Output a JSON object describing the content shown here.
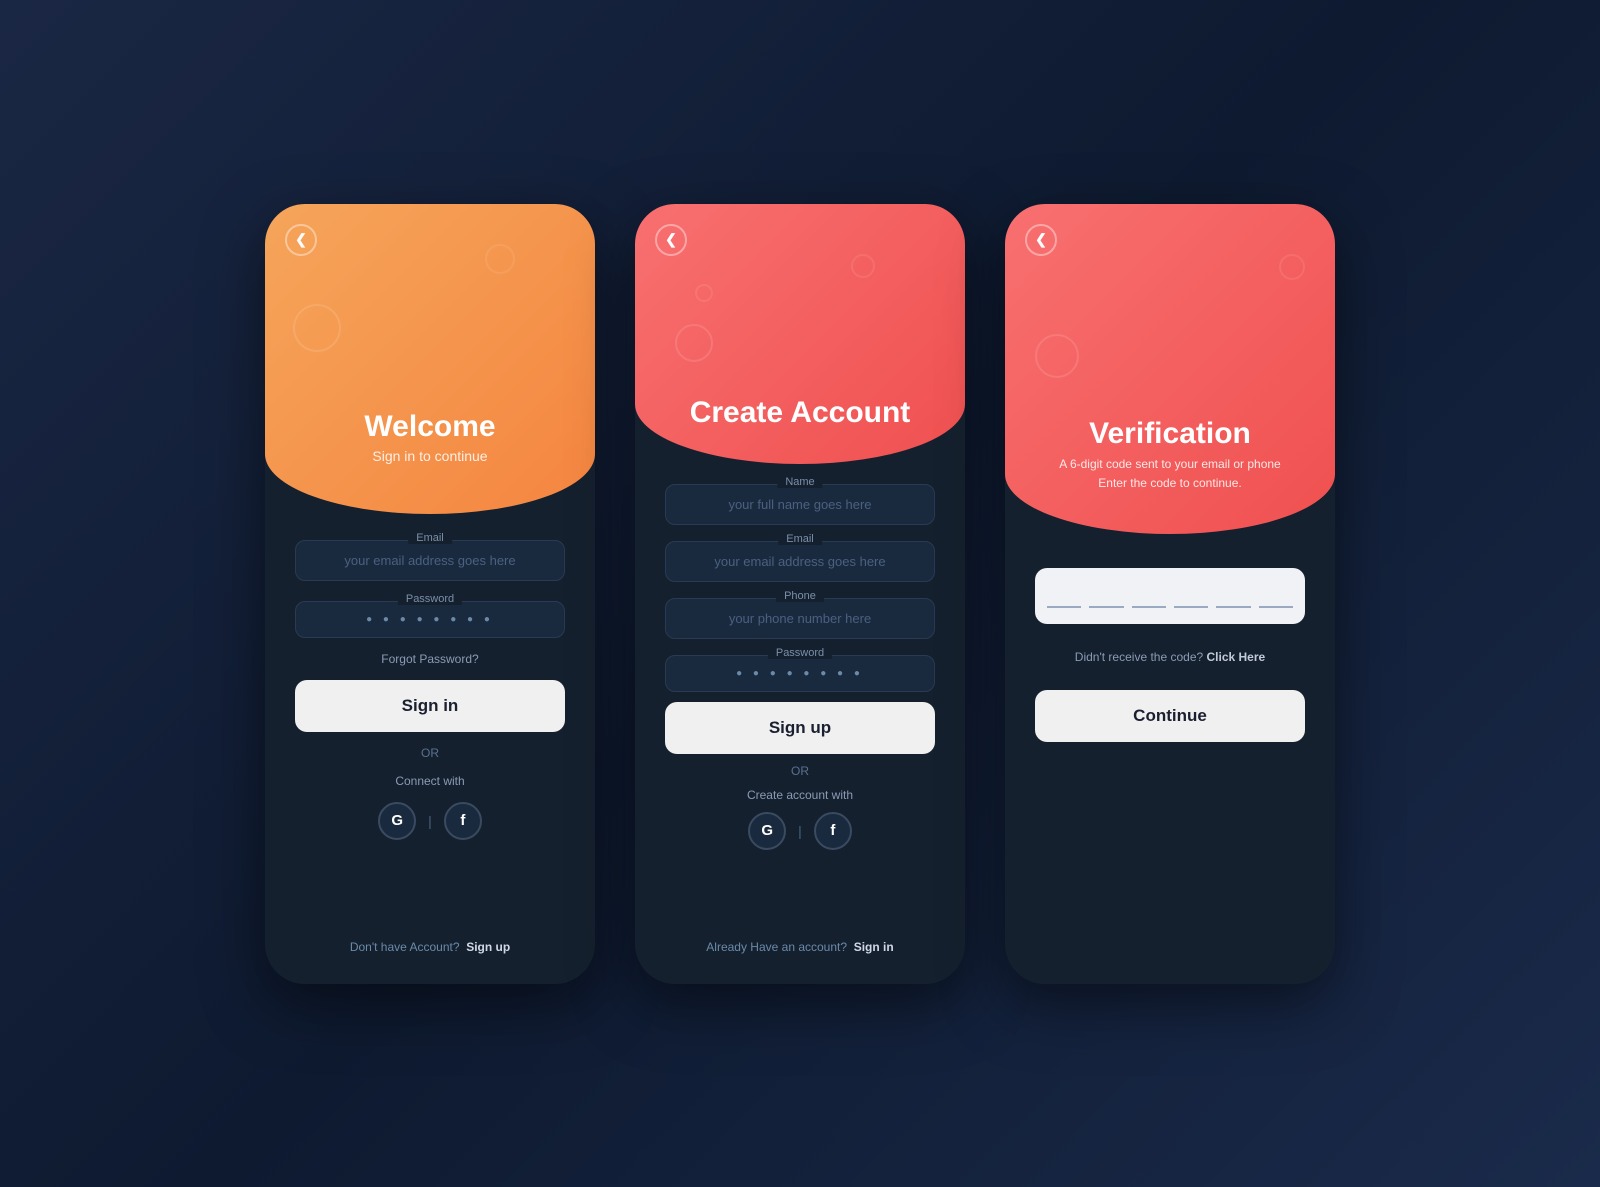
{
  "page": {
    "bg": "#0e1a30"
  },
  "cards": [
    {
      "id": "welcome",
      "header": {
        "type": "orange",
        "title": "Welcome",
        "subtitle": "Sign in to continue",
        "back_label": "<"
      },
      "fields": [
        {
          "label": "Email",
          "placeholder": "your email address goes here",
          "type": "text"
        },
        {
          "label": "Password",
          "placeholder": "●●●●●●●●",
          "type": "password"
        }
      ],
      "forgot_password": "Forgot Password?",
      "primary_btn": "Sign in",
      "divider": "OR",
      "connect_label": "Connect with",
      "socials": [
        "G",
        "f"
      ],
      "footer": "Don't have Account?",
      "footer_action": "Sign up"
    },
    {
      "id": "create-account",
      "header": {
        "type": "coral",
        "title": "Create Account",
        "subtitle": "",
        "back_label": "<"
      },
      "fields": [
        {
          "label": "Name",
          "placeholder": "your full name goes here",
          "type": "text"
        },
        {
          "label": "Email",
          "placeholder": "your email address goes here",
          "type": "text"
        },
        {
          "label": "Phone",
          "placeholder": "your phone number here",
          "type": "text"
        },
        {
          "label": "Password",
          "placeholder": "●●●●●●●●",
          "type": "password"
        }
      ],
      "primary_btn": "Sign up",
      "divider": "OR",
      "connect_label": "Create account with",
      "socials": [
        "G",
        "f"
      ],
      "footer": "Already Have an account?",
      "footer_action": "Sign in"
    },
    {
      "id": "verification",
      "header": {
        "type": "coral",
        "title": "Verification",
        "subtitle": "A 6-digit code sent to your email or phone\nEnter the code to continue.",
        "back_label": "<"
      },
      "code_segments": 6,
      "resend_text": "Didn't receive the code? Click Here",
      "resend_link": "Click Here",
      "primary_btn": "Continue",
      "footer": ""
    }
  ],
  "icons": {
    "google_letter": "G",
    "facebook_letter": "f",
    "back_arrow": "❮"
  }
}
